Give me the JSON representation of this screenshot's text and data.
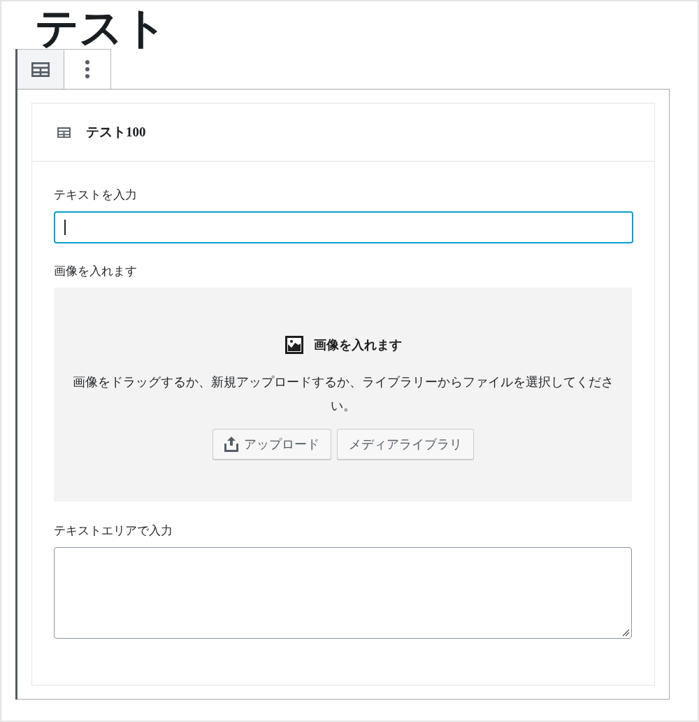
{
  "title": "テスト",
  "toolbar": [
    {
      "kind": "block-type",
      "selected": true
    },
    {
      "kind": "more",
      "selected": false
    }
  ],
  "card": {
    "title": "テスト100",
    "fields": [
      {
        "kind": "text",
        "label": "テキストを入力",
        "focused": true
      },
      {
        "kind": "image",
        "label": "画像を入れます",
        "heading": "画像を入れます",
        "instructions": "画像をドラッグするか、新規アップロードするか、ライブラリーからファイルを選択してください。",
        "buttons": [
          {
            "kind": "upload",
            "label": "アップロード"
          },
          {
            "kind": "library",
            "label": "メディアライブラリ"
          }
        ]
      },
      {
        "kind": "textarea",
        "label": "テキストエリアで入力",
        "focused": false
      }
    ]
  }
}
